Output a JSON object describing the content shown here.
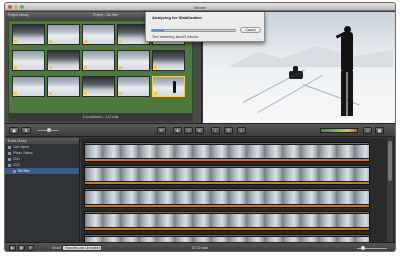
{
  "window": {
    "title": "iMovie"
  },
  "project": {
    "header_left": "Project Library",
    "header_center": "Project – Ski Skei",
    "status": "6.1s selected – 1:13 total"
  },
  "stabilize_dialog": {
    "title": "Analyzing for Stabilization",
    "progress_fraction": 0.15,
    "cancel_label": "Cancel",
    "status": "Time remaining: about 5 minutes"
  },
  "event_library": {
    "header": "Event Library",
    "items": [
      {
        "label": "Last Import",
        "level": 1
      },
      {
        "label": "iPhoto Videos",
        "level": 1
      },
      {
        "label": "2011",
        "level": 1
      },
      {
        "label": "2012",
        "level": 1
      },
      {
        "label": "Ski Skei",
        "level": 2,
        "selected": true
      }
    ]
  },
  "bottom": {
    "show_label": "Show:",
    "show_value": "Favorites and Unmarked",
    "total": "57:22 total"
  },
  "colors": {
    "project_bg": "#4d7a3c",
    "selection_blue": "#3d5a86",
    "filmstrip_stripe": "#d07a20",
    "progress_fill": "#5a8fd6"
  },
  "icons": [
    "camera-import-icon",
    "swap-icon",
    "undo-icon",
    "redo-icon",
    "favorite-icon",
    "unmark-icon",
    "reject-icon",
    "voiceover-icon",
    "crop-icon",
    "adjust-icon",
    "play-icon",
    "fullscreen-icon"
  ]
}
